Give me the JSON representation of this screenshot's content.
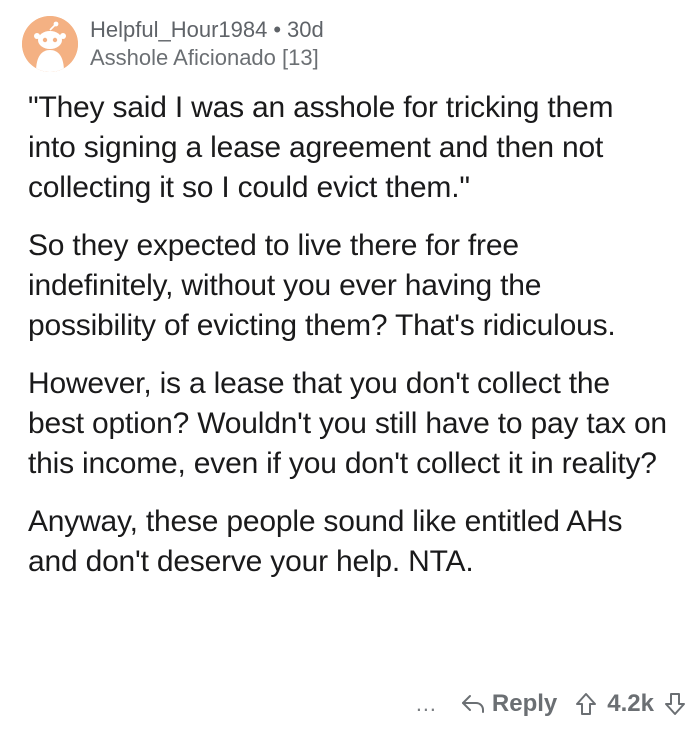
{
  "comment": {
    "author": "Helpful_Hour1984",
    "separator": "•",
    "age": "30d",
    "flair": "Asshole Aficionado [13]",
    "paragraphs": [
      "\"They said I was an asshole for tricking them into signing a lease agreement and then not collecting it so I could evict them.\"",
      "So they expected to live there for free indefinitely, without you ever having the possibility of evicting them? That's ridiculous.",
      "However, is a lease that you don't collect the best option? Wouldn't you still have to pay tax on this income, even if you don't collect it in reality?",
      "Anyway, these people sound like entitled AHs and don't deserve your help. NTA."
    ],
    "actions": {
      "more": "…",
      "reply": "Reply",
      "score": "4.2k"
    }
  },
  "icons": {
    "avatar": "snoo-avatar-icon",
    "more": "more-options-icon",
    "reply": "reply-arrow-icon",
    "upvote": "upvote-arrow-icon",
    "downvote": "downvote-arrow-icon"
  },
  "colors": {
    "avatar_bg": "#f4b183",
    "meta_text": "#5f6368",
    "body_text": "#1a1a1b",
    "action_text": "#6b6f73"
  }
}
